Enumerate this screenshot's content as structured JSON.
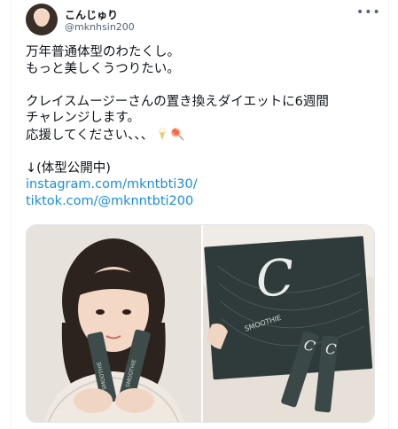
{
  "tweet": {
    "display_name": "こんじゅり",
    "handle": "@mknhsin200",
    "lines": [
      "万年普通体型のわたくし。",
      "もっと美しくうつりたい。",
      "",
      "クレイスムージーさんの置き換えダイエットに6週間",
      "チャレンジします。",
      "応援してください、、、",
      "",
      "↓(体型公開中)"
    ],
    "links": [
      "instagram.com/mkntbti30/",
      "tiktok.com/@mknntbti200"
    ],
    "emoji": [
      "soft-ice-cream-icon",
      "lollipop-icon"
    ]
  },
  "media": {
    "left_image": "selfie-with-sachets-photo",
    "right_image": "product-box-and-sachets-photo",
    "packaging_text": "SMOOTHIE"
  },
  "colors": {
    "link": "#1b8ed6",
    "text": "#0f1419",
    "muted": "#536471"
  }
}
